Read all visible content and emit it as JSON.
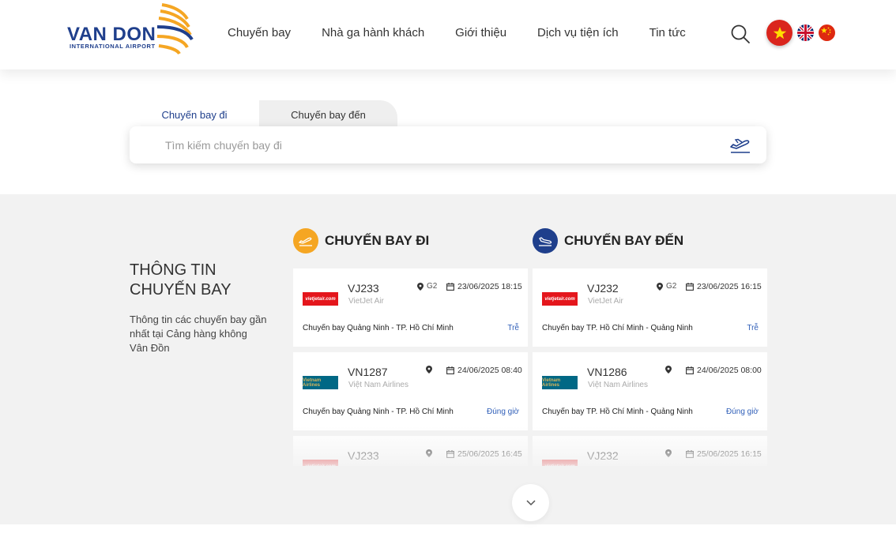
{
  "header": {
    "logo_title": "VAN DON",
    "logo_subtitle": "INTERNATIONAL AIRPORT",
    "nav": [
      {
        "label": "Chuyến bay"
      },
      {
        "label": "Nhà ga hành khách"
      },
      {
        "label": "Giới thiệu"
      },
      {
        "label": "Dịch vụ tiện ích"
      },
      {
        "label": "Tin tức"
      }
    ],
    "search_icon": "search-icon",
    "languages": [
      "vi",
      "en",
      "zh"
    ]
  },
  "search": {
    "tabs": [
      {
        "label": "Chuyến bay đi",
        "active": true
      },
      {
        "label": "Chuyến bay đến",
        "active": false
      }
    ],
    "placeholder": "Tìm kiếm chuyến bay đi",
    "value": "",
    "icon": "plane-takeoff-icon"
  },
  "info": {
    "title": "THÔNG TIN CHUYẾN BAY",
    "description": "Thông tin các chuyến bay gần nhất tại Cảng hàng không Vân Đồn"
  },
  "departures": {
    "title": "CHUYẾN BAY ĐI",
    "accent": "#f5a623",
    "flights": [
      {
        "flight": "VJ233",
        "airline": "VietJet Air",
        "logo": "vietjet",
        "logo_text": "vietjetair.com",
        "gate": "G2",
        "datetime": "23/06/2025 18:15",
        "route": "Chuyến bay Quảng Ninh - TP. Hồ Chí Minh",
        "status": "Trễ"
      },
      {
        "flight": "VN1287",
        "airline": "Việt Nam Airlines",
        "logo": "vietnam",
        "logo_text": "Vietnam Airlines",
        "gate": "",
        "datetime": "24/06/2025 08:40",
        "route": "Chuyến bay Quảng Ninh - TP. Hồ Chí Minh",
        "status": "Đúng giờ"
      },
      {
        "flight": "VJ233",
        "airline": "VietJet Air",
        "logo": "vietjet",
        "logo_text": "vietjetair.com",
        "gate": "",
        "datetime": "25/06/2025 16:45",
        "route": "",
        "status": ""
      }
    ]
  },
  "arrivals": {
    "title": "CHUYẾN BAY ĐẾN",
    "accent": "#1f3f8c",
    "flights": [
      {
        "flight": "VJ232",
        "airline": "VietJet Air",
        "logo": "vietjet",
        "logo_text": "vietjetair.com",
        "gate": "G2",
        "datetime": "23/06/2025 16:15",
        "route": "Chuyến bay TP. Hồ Chí Minh - Quảng Ninh",
        "status": "Trễ"
      },
      {
        "flight": "VN1286",
        "airline": "Việt Nam Airlines",
        "logo": "vietnam",
        "logo_text": "Vietnam Airlines",
        "gate": "",
        "datetime": "24/06/2025 08:00",
        "route": "Chuyến bay TP. Hồ Chí Minh - Quảng Ninh",
        "status": "Đúng giờ"
      },
      {
        "flight": "VJ232",
        "airline": "VietJet Air",
        "logo": "vietjet",
        "logo_text": "vietjetair.com",
        "gate": "",
        "datetime": "25/06/2025 16:15",
        "route": "",
        "status": ""
      }
    ]
  },
  "more_button_icon": "chevron-down-icon"
}
